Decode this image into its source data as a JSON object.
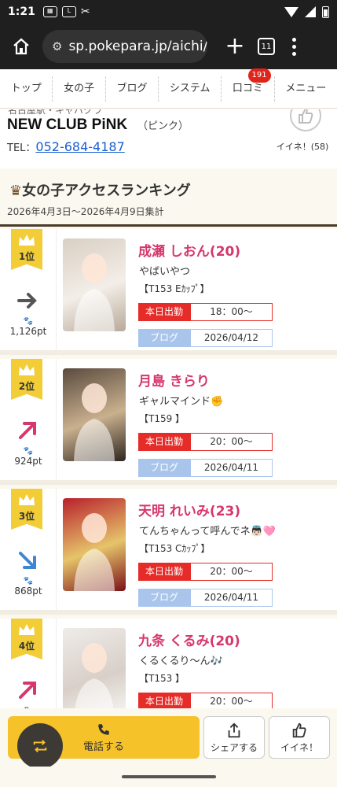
{
  "status": {
    "time": "1:21"
  },
  "browser": {
    "url": "sp.pokepara.jp/aichi/",
    "tab_count": "11"
  },
  "nav": {
    "items": [
      {
        "label": "トップ"
      },
      {
        "label": "女の子"
      },
      {
        "label": "ブログ"
      },
      {
        "label": "システム"
      },
      {
        "label": "口コミ",
        "badge": "191"
      },
      {
        "label": "メニュー"
      }
    ]
  },
  "shop": {
    "cut_text": "名古屋駅・キャバクラ",
    "name": "NEW CLUB PiNK",
    "kana": "（ピンク）",
    "tel_label": "TEL：",
    "tel": "052-684-4187",
    "iine_label": "イイネ！(58)"
  },
  "ranking": {
    "title": "女の子アクセスランキング",
    "period": "2026年4月3日〜2026年4月9日集計",
    "work_label": "本日出勤",
    "blog_label": "ブログ",
    "entries": [
      {
        "rank": "1位",
        "trend": "flat",
        "points": "1,126pt",
        "name": "成瀬 しおん(20)",
        "catch": "やばいやつ",
        "spec": "【T153 Eｶｯﾌﾟ】",
        "work_time": "18：00〜",
        "blog_date": "2026/04/12",
        "photo_colors": [
          "#d9cfc4",
          "#f3eee8",
          "#b9a99a"
        ]
      },
      {
        "rank": "2位",
        "trend": "up",
        "points": "924pt",
        "name": "月島 きらり",
        "catch": "ギャルマインド✊",
        "spec": "【T159 】",
        "work_time": "20：00〜",
        "blog_date": "2026/04/11",
        "photo_colors": [
          "#5a4a3e",
          "#c9b08e",
          "#2e2620"
        ]
      },
      {
        "rank": "3位",
        "trend": "down",
        "points": "868pt",
        "name": "天明 れいみ(23)",
        "catch": "てんちゃんって呼んでネ👼🏻🩷",
        "spec": "【T153 Cｶｯﾌﾟ】",
        "work_time": "20：00〜",
        "blog_date": "2026/04/11",
        "photo_colors": [
          "#b8202c",
          "#e6c46a",
          "#7a1218"
        ]
      },
      {
        "rank": "4位",
        "trend": "up",
        "points": "",
        "name": "九条 くるみ(20)",
        "catch": "くるくるり〜ん🎶",
        "spec": "【T153 】",
        "work_time": "20：00〜",
        "blog_date": "",
        "photo_colors": [
          "#efece9",
          "#d8cfc8",
          "#fbfaf8"
        ]
      }
    ]
  },
  "bottom": {
    "call_label": "電話する",
    "share_label": "シェアする",
    "like_label": "イイネ！"
  },
  "colors": {
    "accent_pink": "#d6376d",
    "work_red": "#e62c28",
    "blog_blue": "#a9c5ec",
    "gold": "#f2cd37"
  }
}
